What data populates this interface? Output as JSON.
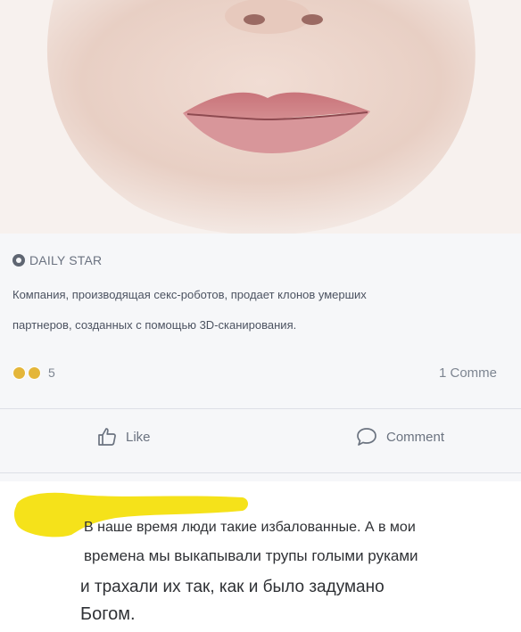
{
  "post": {
    "source_name": "DAILY STAR",
    "headline_line1": "Компания, производящая секс-роботов, продает клонов умерших",
    "headline_line2": "партнеров, созданных с помощью 3D-сканирования.",
    "reaction_count": "5",
    "comment_count": "1 Comme",
    "like_label": "Like",
    "comment_label": "Comment"
  },
  "comment": {
    "line1": "В наше время люди такие избалованные. А в мои",
    "line2": "времена мы выкапывали трупы голыми руками",
    "line3": "и трахали их так, как и было задумано",
    "line4": "Богом."
  },
  "colors": {
    "highlight": "#f5e21a",
    "text_gray": "#6b7380"
  }
}
